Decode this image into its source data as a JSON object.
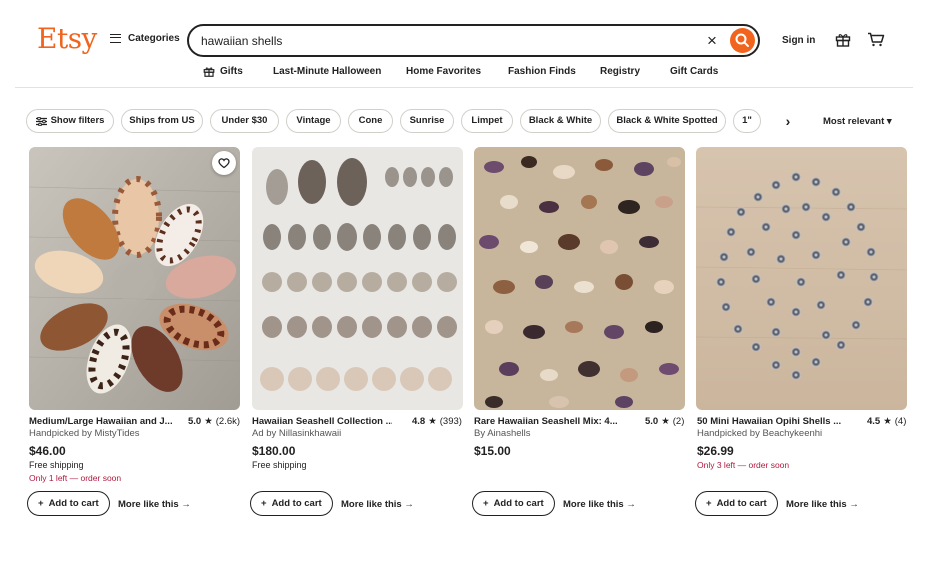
{
  "header": {
    "logo": "Etsy",
    "categories_label": "Categories",
    "search_value": "hawaiian shells",
    "sign_in": "Sign in"
  },
  "nav": [
    "Gifts",
    "Last-Minute Halloween",
    "Home Favorites",
    "Fashion Finds",
    "Registry",
    "Gift Cards"
  ],
  "filters": [
    "Show filters",
    "Ships from US",
    "Under $30",
    "Vintage",
    "Cone",
    "Sunrise",
    "Limpet",
    "Black & White",
    "Black & White Spotted",
    "1\""
  ],
  "sort_label": "Most relevant",
  "products": [
    {
      "title": "Medium/Large Hawaiian and J...",
      "rating": "5.0",
      "reviews": "(2.6k)",
      "shop": "Handpicked by MistyTides",
      "price": "$46.00",
      "shipping": "Free shipping",
      "stock": "Only 1 left — order soon",
      "add_to_cart": "Add to cart",
      "more": "More like this"
    },
    {
      "title": "Hawaiian Seashell Collection ...",
      "rating": "4.8",
      "reviews": "(393)",
      "shop": "Ad by Nillasinkhawaii",
      "price": "$180.00",
      "shipping": "Free shipping",
      "stock": "",
      "add_to_cart": "Add to cart",
      "more": "More like this"
    },
    {
      "title": "Rare Hawaiian Seashell Mix: 4...",
      "rating": "5.0",
      "reviews": "(2)",
      "shop": "By Ainashells",
      "price": "$15.00",
      "shipping": "",
      "stock": "",
      "add_to_cart": "Add to cart",
      "more": "More like this"
    },
    {
      "title": "50 Mini Hawaiian Opihi Shells ...",
      "rating": "4.5",
      "reviews": "(4)",
      "shop": "Handpicked by Beachykeenhi",
      "price": "$26.99",
      "shipping": "",
      "stock": "Only 3 left — order soon",
      "add_to_cart": "Add to cart",
      "more": "More like this"
    }
  ],
  "colors": {
    "brand": "#f1641e",
    "stock_warning": "#b1193f"
  }
}
